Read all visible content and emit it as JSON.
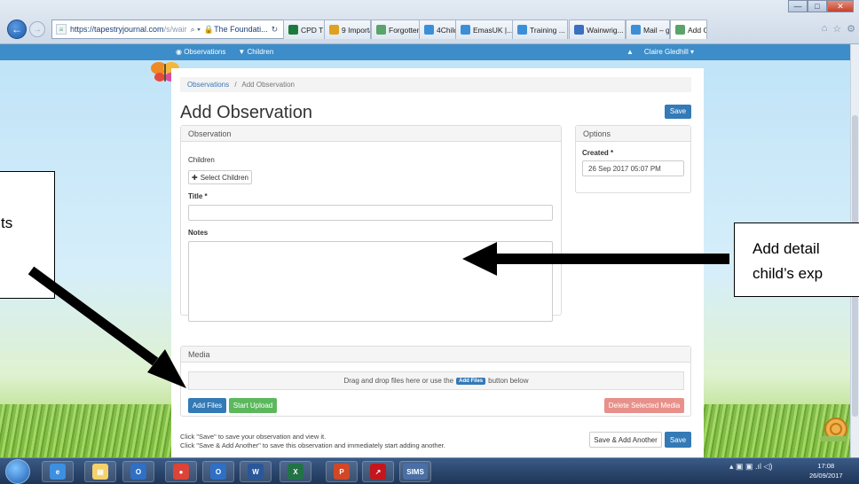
{
  "browser": {
    "url_main": "https://tapestryjournal.com",
    "url_rest": "/s/wair",
    "address_controls": "⌕ ▾",
    "lock_label": "The Foundati...",
    "tabs": [
      {
        "label": "CPD TRA...",
        "color": "#1e7a3c"
      },
      {
        "label": "9 Importa...",
        "color": "#e0a020"
      },
      {
        "label": "Forgotten...",
        "color": "#5aa36a"
      },
      {
        "label": "4Children...",
        "color": "#3c8fd6"
      },
      {
        "label": "EmasUK |...",
        "color": "#3c8fd6"
      },
      {
        "label": "Training ...",
        "color": "#3c8fd6"
      },
      {
        "label": "Wainwrig...",
        "color": "#3a6fc2"
      },
      {
        "label": "Mail – gle...",
        "color": "#3c8fd6"
      },
      {
        "label": "Add O...",
        "color": "#5aa36a"
      }
    ],
    "active_close": "×"
  },
  "appbar": {
    "observations": "◉ Observations",
    "children": "▼ Children",
    "bell": "▲",
    "user": "Claire Gledhill ▾"
  },
  "breadcrumb": {
    "first": "Observations",
    "sep": "/",
    "current": "Add Observation"
  },
  "title": "Add Observation",
  "save_label": "Save",
  "observation": {
    "heading": "Observation",
    "children_label": "Children",
    "select_children": "Select Children",
    "title_label": "Title *",
    "title_value": "",
    "notes_label": "Notes",
    "notes_value": ""
  },
  "options": {
    "heading": "Options",
    "created_label": "Created *",
    "created_value": "26 Sep 2017 05:07 PM"
  },
  "media": {
    "heading": "Media",
    "drop_text_1": "Drag and drop files here or use the",
    "drop_mini": "Add Files",
    "drop_text_2": "button below",
    "add_files": "Add Files",
    "start_upload": "Start Upload",
    "delete_selected": "Delete Selected Media"
  },
  "footer": {
    "help_1": "Click \"Save\" to save your observation and view it.",
    "help_2": "Click \"Save & Add Another\" to save this observation and immediately start adding another.",
    "save_add_another": "Save & Add Another",
    "save": "Save"
  },
  "callouts": {
    "left_text": "ts",
    "right_line_1": "Add detail",
    "right_line_2": "child’s exp"
  },
  "taskbar": {
    "apps": [
      "IE",
      "Folder",
      "Outlook",
      "Chrome",
      "Outlook",
      "Word",
      "Excel",
      "PowerPoint",
      "PDF",
      "SIMS"
    ],
    "sims_label": "SIMS",
    "tray": "▴  ▣  ▣  .ıl  ◁)",
    "time": "17:08",
    "date": "26/09/2017"
  },
  "colors": {
    "primary": "#337ab7",
    "success": "#5cb85c",
    "danger_light": "#e8908a",
    "appbar": "#3c8dc9"
  }
}
